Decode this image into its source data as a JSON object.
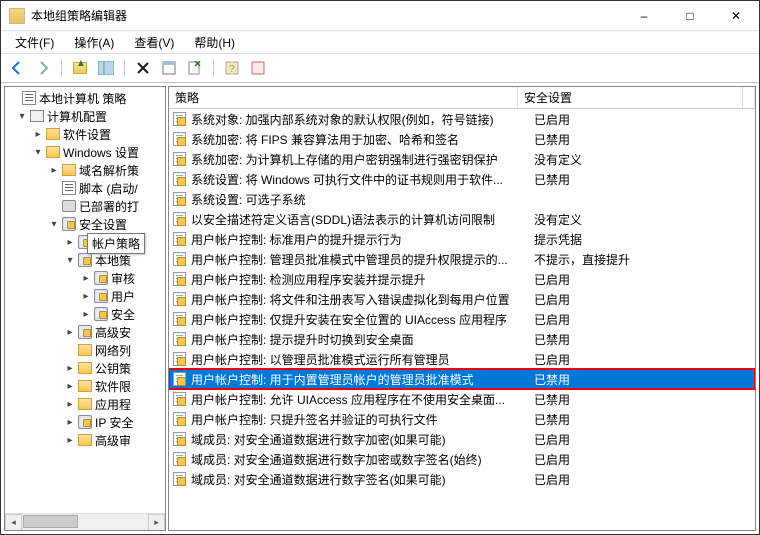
{
  "window": {
    "title": "本地组策略编辑器"
  },
  "menubar": {
    "file": "文件(F)",
    "action": "操作(A)",
    "view": "查看(V)",
    "help": "帮助(H)"
  },
  "tree": {
    "root": "本地计算机 策略",
    "computer_config": "计算机配置",
    "software_settings": "软件设置",
    "windows_settings": "Windows 设置",
    "dns_policy": "域名解析策",
    "scripts": "脚本 (启动/",
    "deployed": "已部署的打",
    "security_settings": "安全设置",
    "account_policy_short": "帐户",
    "account_policy_tooltip": "帐户策略",
    "local_policy": "本地策",
    "audit": "审核",
    "user_rights": "用户",
    "security_options": "安全",
    "advanced_security": "高级安",
    "network_list": "网络列",
    "public_key": "公钥策",
    "software_restrict": "软件限",
    "app_control": "应用程",
    "ip_security": "IP 安全",
    "advanced_audit": "高级审"
  },
  "list_header": {
    "policy": "策略",
    "setting": "安全设置"
  },
  "policies": [
    {
      "name": "系统对象: 加强内部系统对象的默认权限(例如，符号链接)",
      "setting": "已启用"
    },
    {
      "name": "系统加密: 将 FIPS 兼容算法用于加密、哈希和签名",
      "setting": "已禁用"
    },
    {
      "name": "系统加密: 为计算机上存储的用户密钥强制进行强密钥保护",
      "setting": "没有定义"
    },
    {
      "name": "系统设置: 将 Windows 可执行文件中的证书规则用于软件...",
      "setting": "已禁用"
    },
    {
      "name": "系统设置: 可选子系统",
      "setting": ""
    },
    {
      "name": "以安全描述符定义语言(SDDL)语法表示的计算机访问限制",
      "setting": "没有定义"
    },
    {
      "name": "用户帐户控制: 标准用户的提升提示行为",
      "setting": "提示凭据"
    },
    {
      "name": "用户帐户控制: 管理员批准模式中管理员的提升权限提示的...",
      "setting": "不提示，直接提升"
    },
    {
      "name": "用户帐户控制: 检测应用程序安装并提示提升",
      "setting": "已启用"
    },
    {
      "name": "用户帐户控制: 将文件和注册表写入错误虚拟化到每用户位置",
      "setting": "已启用"
    },
    {
      "name": "用户帐户控制: 仅提升安装在安全位置的 UIAccess 应用程序",
      "setting": "已启用"
    },
    {
      "name": "用户帐户控制: 提示提升时切换到安全桌面",
      "setting": "已禁用"
    },
    {
      "name": "用户帐户控制: 以管理员批准模式运行所有管理员",
      "setting": "已启用"
    },
    {
      "name": "用户帐户控制: 用于内置管理员帐户的管理员批准模式",
      "setting": "已禁用",
      "selected": true
    },
    {
      "name": "用户帐户控制: 允许 UIAccess 应用程序在不使用安全桌面...",
      "setting": "已禁用"
    },
    {
      "name": "用户帐户控制: 只提升签名并验证的可执行文件",
      "setting": "已禁用"
    },
    {
      "name": "域成员: 对安全通道数据进行数字加密(如果可能)",
      "setting": "已启用"
    },
    {
      "name": "域成员: 对安全通道数据进行数字加密或数字签名(始终)",
      "setting": "已启用"
    },
    {
      "name": "域成员: 对安全通道数据进行数字签名(如果可能)",
      "setting": "已启用"
    }
  ]
}
